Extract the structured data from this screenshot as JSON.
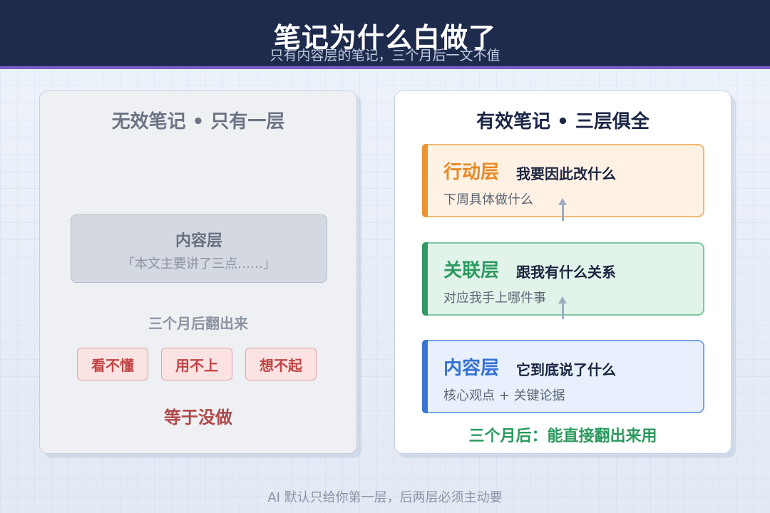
{
  "header": {
    "title": "笔记为什么白做了",
    "subtitle": "只有内容层的笔记，三个月后一文不值"
  },
  "left_panel": {
    "title": "无效笔记 • 只有一层",
    "content_box": {
      "title": "内容层",
      "subtitle": "「本文主要讲了三点……」"
    },
    "months_label": "三个月后翻出来",
    "tags": [
      "看不懂",
      "用不上",
      "想不起"
    ],
    "result": "等于没做"
  },
  "right_panel": {
    "title": "有效笔记 • 三层俱全",
    "layers": [
      {
        "name": "行动层",
        "question": "我要因此改什么",
        "desc": "下周具体做什么"
      },
      {
        "name": "关联层",
        "question": "跟我有什么关系",
        "desc": "对应我手上哪件事"
      },
      {
        "name": "内容层",
        "question": "它到底说了什么",
        "desc": "核心观点 + 关键论据"
      }
    ],
    "result": "三个月后：能直接翻出来用"
  },
  "footer": "AI 默认只给你第一层，后两层必须主动要",
  "colors": {
    "header_bg": "#1e2b4c",
    "accent_bar": "#7b5fc7",
    "action": "#ec9230",
    "link": "#2f9a62",
    "content": "#3874d6",
    "warning": "#c24444"
  }
}
